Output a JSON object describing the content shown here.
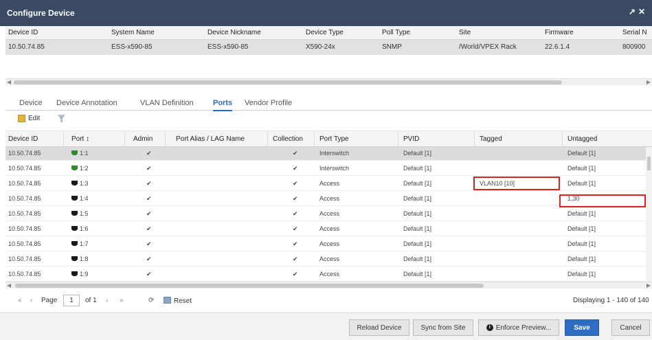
{
  "window": {
    "title": "Configure Device",
    "icons": [
      "expand-icon",
      "close-icon"
    ]
  },
  "device_table": {
    "headers": [
      "Device ID",
      "System Name",
      "Device Nickname",
      "Device Type",
      "Poll Type",
      "Site",
      "Firmware",
      "Serial N"
    ],
    "row": [
      "10.50.74.85",
      "ESS-x590-85",
      "ESS-x590-85",
      "X590-24x",
      "SNMP",
      "/World/VPEX Rack",
      "22.6.1.4",
      "800900"
    ]
  },
  "tabs": [
    "Device",
    "Device Annotation",
    "VLAN Definition",
    "Ports",
    "Vendor Profile"
  ],
  "active_tab": "Ports",
  "toolbar": {
    "edit_label": "Edit"
  },
  "ports_table": {
    "headers": [
      "Device ID",
      "Port ↕",
      "Admin",
      "Port Alias / LAG Name",
      "Collection",
      "Port Type",
      "PVID",
      "Tagged",
      "Untagged"
    ],
    "rows": [
      {
        "device": "10.50.74.85",
        "port": "1:1",
        "status": "up",
        "admin": "✔",
        "alias": "",
        "collection": "✔",
        "type": "Interswitch",
        "pvid": "Default [1]",
        "tagged": "",
        "untagged": "Default [1]"
      },
      {
        "device": "10.50.74.85",
        "port": "1:2",
        "status": "up",
        "admin": "✔",
        "alias": "",
        "collection": "✔",
        "type": "Interswitch",
        "pvid": "Default [1]",
        "tagged": "",
        "untagged": "Default [1]"
      },
      {
        "device": "10.50.74.85",
        "port": "1:3",
        "status": "down",
        "admin": "✔",
        "alias": "",
        "collection": "✔",
        "type": "Access",
        "pvid": "Default [1]",
        "tagged": "VLAN10 [10]",
        "untagged": "Default [1]"
      },
      {
        "device": "10.50.74.85",
        "port": "1:4",
        "status": "down",
        "admin": "✔",
        "alias": "",
        "collection": "✔",
        "type": "Access",
        "pvid": "Default [1]",
        "tagged": "",
        "untagged": "1,30"
      },
      {
        "device": "10.50.74.85",
        "port": "1:5",
        "status": "down",
        "admin": "✔",
        "alias": "",
        "collection": "✔",
        "type": "Access",
        "pvid": "Default [1]",
        "tagged": "",
        "untagged": "Default [1]"
      },
      {
        "device": "10.50.74.85",
        "port": "1:6",
        "status": "down",
        "admin": "✔",
        "alias": "",
        "collection": "✔",
        "type": "Access",
        "pvid": "Default [1]",
        "tagged": "",
        "untagged": "Default [1]"
      },
      {
        "device": "10.50.74.85",
        "port": "1:7",
        "status": "down",
        "admin": "✔",
        "alias": "",
        "collection": "✔",
        "type": "Access",
        "pvid": "Default [1]",
        "tagged": "",
        "untagged": "Default [1]"
      },
      {
        "device": "10.50.74.85",
        "port": "1:8",
        "status": "down",
        "admin": "✔",
        "alias": "",
        "collection": "✔",
        "type": "Access",
        "pvid": "Default [1]",
        "tagged": "",
        "untagged": "Default [1]"
      },
      {
        "device": "10.50.74.85",
        "port": "1:9",
        "status": "down",
        "admin": "✔",
        "alias": "",
        "collection": "✔",
        "type": "Access",
        "pvid": "Default [1]",
        "tagged": "",
        "untagged": "Default [1]"
      }
    ]
  },
  "pager": {
    "first": "«",
    "prev": "‹",
    "page_label": "Page",
    "page_value": "1",
    "of_label": "of 1",
    "next": "›",
    "last": "»",
    "reset_label": "Reset",
    "displaying": "Displaying 1 - 140 of 140"
  },
  "footer": {
    "reload": "Reload Device",
    "sync": "Sync from Site",
    "enforce": "Enforce Preview...",
    "save": "Save",
    "cancel": "Cancel"
  },
  "colors": {
    "titlebar": "#3a4a63",
    "accent": "#2f6dc3",
    "highlight": "#e02020",
    "port_up": "#2e8b2e",
    "port_down": "#1a1a1a"
  }
}
